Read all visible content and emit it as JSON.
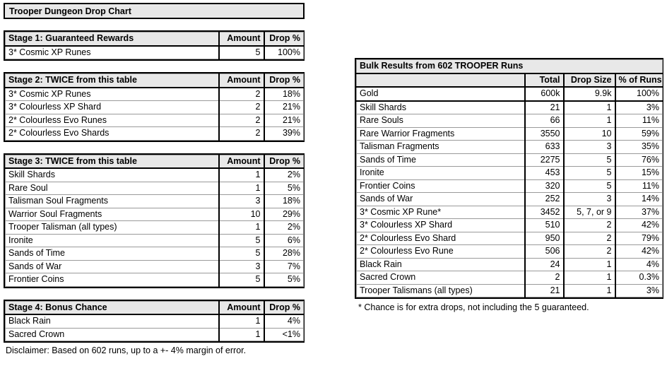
{
  "document": {
    "title": "Trooper Dungeon Drop Chart"
  },
  "left_column": {
    "stages": [
      {
        "header": "Stage 1: Guaranteed Rewards",
        "col_amount": "Amount",
        "col_drop": "Drop %",
        "rows": [
          {
            "name": "3* Cosmic XP Runes",
            "amount": "5",
            "drop": "100%"
          }
        ]
      },
      {
        "header": "Stage 2: TWICE from this table",
        "col_amount": "Amount",
        "col_drop": "Drop %",
        "rows": [
          {
            "name": "3* Cosmic XP Runes",
            "amount": "2",
            "drop": "18%"
          },
          {
            "name": "3* Colourless XP Shard",
            "amount": "2",
            "drop": "21%"
          },
          {
            "name": "2* Colourless Evo Runes",
            "amount": "2",
            "drop": "21%"
          },
          {
            "name": "2* Colourless Evo Shards",
            "amount": "2",
            "drop": "39%"
          }
        ]
      },
      {
        "header": "Stage 3: TWICE from this table",
        "col_amount": "Amount",
        "col_drop": "Drop %",
        "rows": [
          {
            "name": "Skill Shards",
            "amount": "1",
            "drop": "2%"
          },
          {
            "name": "Rare Soul",
            "amount": "1",
            "drop": "5%"
          },
          {
            "name": "Talisman Soul Fragments",
            "amount": "3",
            "drop": "18%"
          },
          {
            "name": "Warrior Soul Fragments",
            "amount": "10",
            "drop": "29%"
          },
          {
            "name": "Trooper Talisman (all types)",
            "amount": "1",
            "drop": "2%"
          },
          {
            "name": "Ironite",
            "amount": "5",
            "drop": "6%"
          },
          {
            "name": "Sands of Time",
            "amount": "5",
            "drop": "28%"
          },
          {
            "name": "Sands of War",
            "amount": "3",
            "drop": "7%"
          },
          {
            "name": "Frontier Coins",
            "amount": "5",
            "drop": "5%"
          }
        ]
      },
      {
        "header": "Stage 4: Bonus Chance",
        "col_amount": "Amount",
        "col_drop": "Drop %",
        "rows": [
          {
            "name": "Black Rain",
            "amount": "1",
            "drop": "4%"
          },
          {
            "name": "Sacred Crown",
            "amount": "1",
            "drop": "<1%"
          }
        ]
      }
    ],
    "disclaimer": "Disclaimer: Based on 602 runs, up to a +- 4% margin of error."
  },
  "bulk_results": {
    "header": "Bulk Results from 602 TROOPER Runs",
    "columns": {
      "name": "",
      "total": "Total",
      "drop_size": "Drop Size",
      "pct_of_runs": "% of Runs"
    },
    "rows": [
      {
        "name": "Gold",
        "total": "600k",
        "drop_size": "9.9k",
        "pct": "100%"
      },
      {
        "name": "Skill Shards",
        "total": "21",
        "drop_size": "1",
        "pct": "3%"
      },
      {
        "name": "Rare Souls",
        "total": "66",
        "drop_size": "1",
        "pct": "11%"
      },
      {
        "name": "Rare Warrior Fragments",
        "total": "3550",
        "drop_size": "10",
        "pct": "59%"
      },
      {
        "name": "Talisman Fragments",
        "total": "633",
        "drop_size": "3",
        "pct": "35%"
      },
      {
        "name": "Sands of Time",
        "total": "2275",
        "drop_size": "5",
        "pct": "76%"
      },
      {
        "name": "Ironite",
        "total": "453",
        "drop_size": "5",
        "pct": "15%"
      },
      {
        "name": "Frontier Coins",
        "total": "320",
        "drop_size": "5",
        "pct": "11%"
      },
      {
        "name": "Sands of War",
        "total": "252",
        "drop_size": "3",
        "pct": "14%"
      },
      {
        "name": "3* Cosmic XP Rune*",
        "total": "3452",
        "drop_size": "5, 7, or 9",
        "pct": "37%"
      },
      {
        "name": "3* Colourless XP Shard",
        "total": "510",
        "drop_size": "2",
        "pct": "42%"
      },
      {
        "name": "2* Colourless Evo Shard",
        "total": "950",
        "drop_size": "2",
        "pct": "79%"
      },
      {
        "name": "2* Colourless Evo Rune",
        "total": "506",
        "drop_size": "2",
        "pct": "42%"
      },
      {
        "name": "Black Rain",
        "total": "24",
        "drop_size": "1",
        "pct": "4%"
      },
      {
        "name": "Sacred Crown",
        "total": "2",
        "drop_size": "1",
        "pct": "0.3%"
      },
      {
        "name": "Trooper Talismans (all types)",
        "total": "21",
        "drop_size": "1",
        "pct": "3%"
      }
    ],
    "footnote": "* Chance is for extra drops, not including the 5 guaranteed."
  },
  "colors": {
    "header_fill": "#e8e8e8",
    "grid_line": "#9a9a9a",
    "frame": "#000000",
    "text": "#000000",
    "page_bg": "#ffffff"
  }
}
